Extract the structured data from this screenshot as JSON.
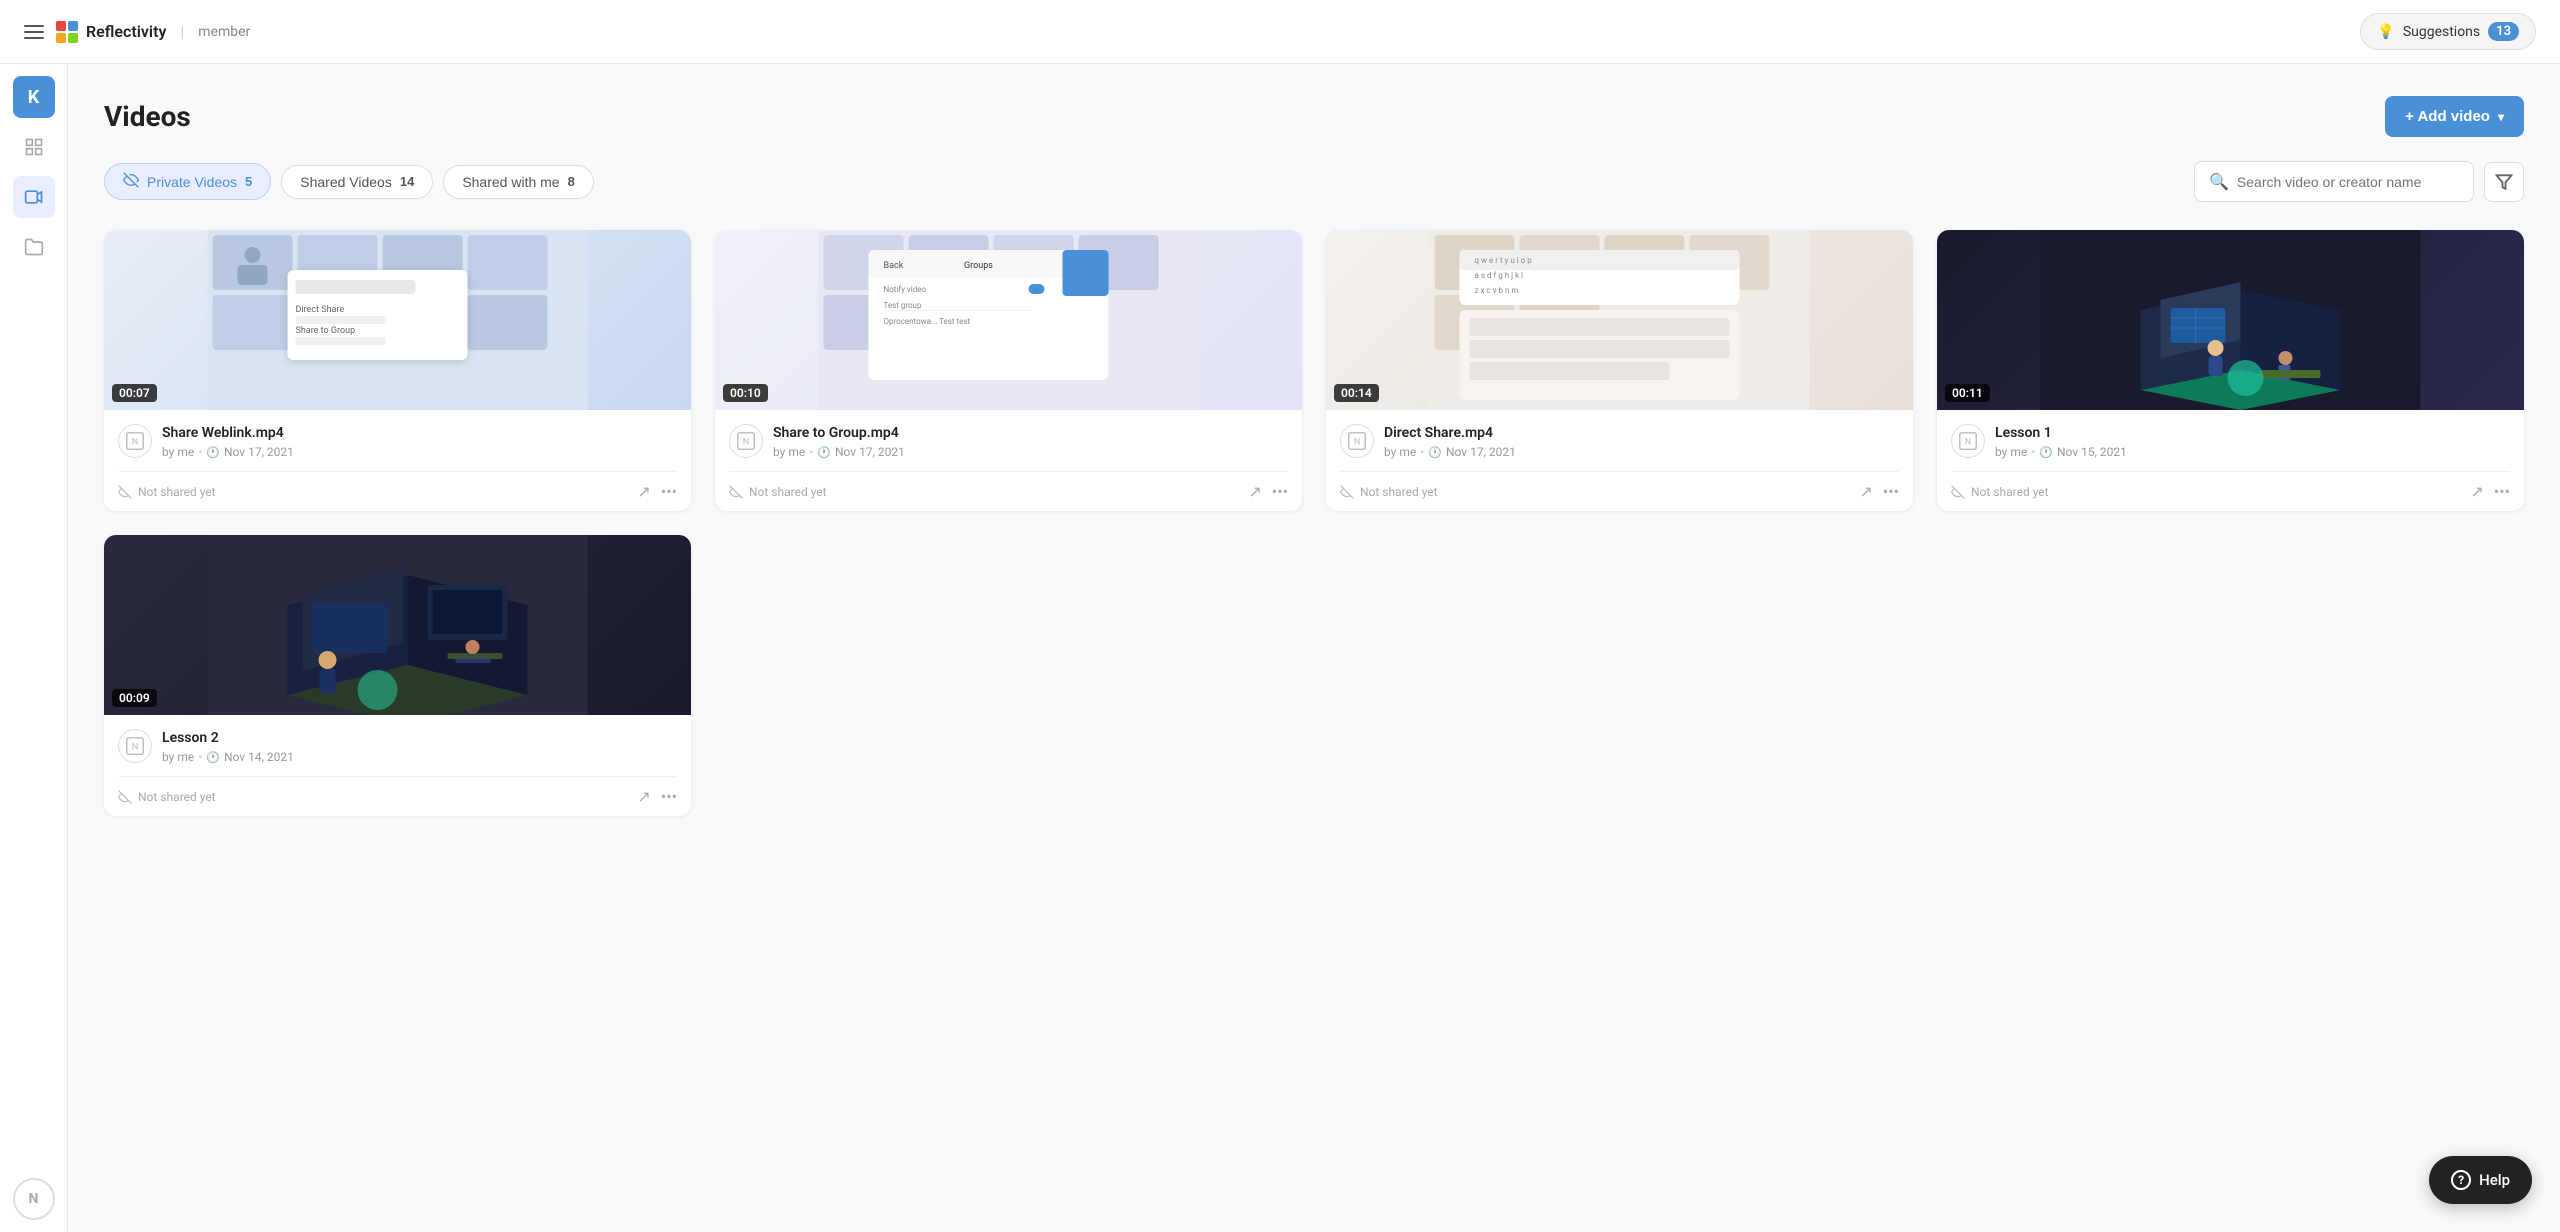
{
  "navbar": {
    "hamburger_label": "menu",
    "logo_text": "Reflectivity",
    "logo_divider": "|",
    "logo_role": "member",
    "suggestions_label": "Suggestions",
    "suggestions_count": "13"
  },
  "sidebar": {
    "avatar_letter": "K",
    "items": [
      {
        "id": "dashboard",
        "icon": "⊞",
        "label": "Dashboard"
      },
      {
        "id": "videos",
        "icon": "▶",
        "label": "Videos",
        "active": true
      },
      {
        "id": "folders",
        "icon": "▣",
        "label": "Folders"
      }
    ],
    "bottom_icon": "N"
  },
  "page": {
    "title": "Videos",
    "add_video_label": "+ Add video"
  },
  "tabs": [
    {
      "id": "private",
      "label": "Private Videos",
      "count": "5",
      "active": true,
      "icon": "👁‍🗨"
    },
    {
      "id": "shared",
      "label": "Shared Videos",
      "count": "14",
      "active": false,
      "icon": ""
    },
    {
      "id": "shared_with_me",
      "label": "Shared with me",
      "count": "8",
      "active": false,
      "icon": ""
    }
  ],
  "search": {
    "placeholder": "Search video or creator name"
  },
  "videos": [
    {
      "id": "v1",
      "title": "Share Weblink.mp4",
      "author": "by me",
      "date": "Nov 17, 2021",
      "duration": "00:07",
      "shared_status": "Not shared yet",
      "thumb_type": "share-weblink"
    },
    {
      "id": "v2",
      "title": "Share to Group.mp4",
      "author": "by me",
      "date": "Nov 17, 2021",
      "duration": "00:10",
      "shared_status": "Not shared yet",
      "thumb_type": "share-group"
    },
    {
      "id": "v3",
      "title": "Direct Share.mp4",
      "author": "by me",
      "date": "Nov 17, 2021",
      "duration": "00:14",
      "shared_status": "Not shared yet",
      "thumb_type": "direct-share"
    },
    {
      "id": "v4",
      "title": "Lesson 1",
      "author": "by me",
      "date": "Nov 15, 2021",
      "duration": "00:11",
      "shared_status": "Not shared yet",
      "thumb_type": "lesson1"
    },
    {
      "id": "v5",
      "title": "Lesson 2",
      "author": "by me",
      "date": "Nov 14, 2021",
      "duration": "00:09",
      "shared_status": "Not shared yet",
      "thumb_type": "lesson2"
    }
  ],
  "help": {
    "label": "Help",
    "icon": "?"
  }
}
